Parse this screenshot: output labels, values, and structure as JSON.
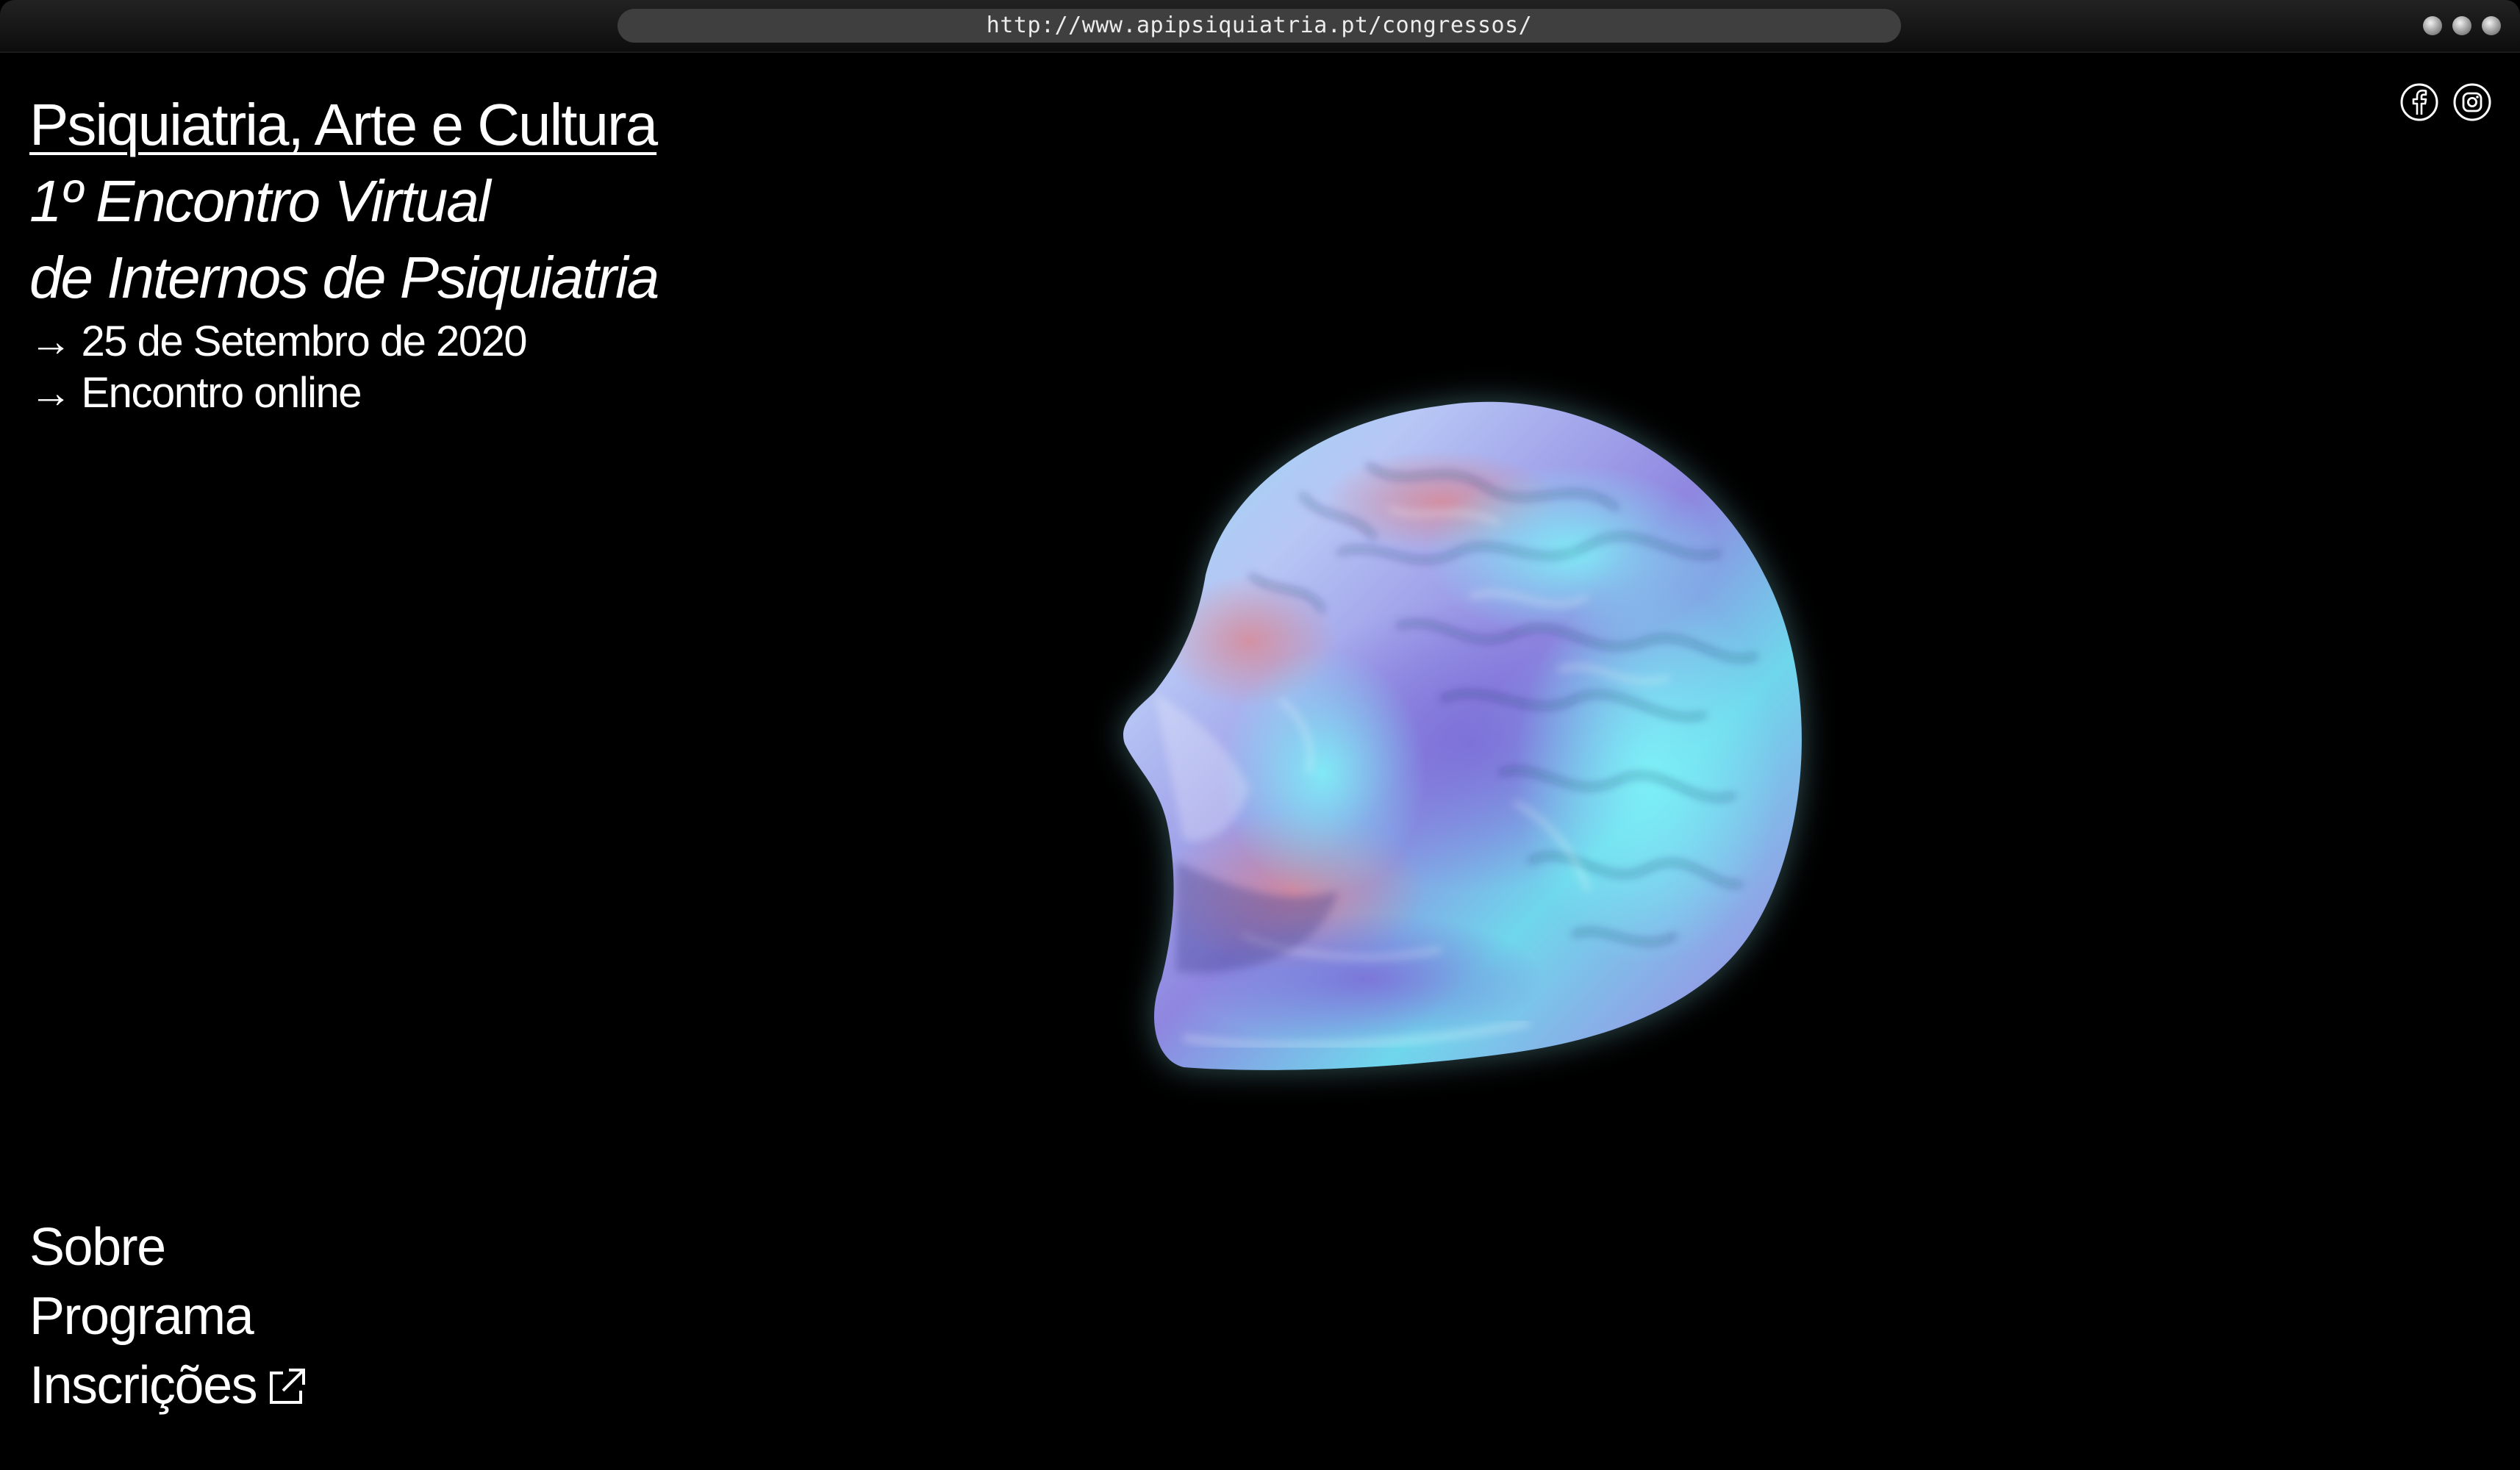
{
  "browser": {
    "url": "http://www.apipsiquiatria.pt/congressos/"
  },
  "hero": {
    "title": "Psiquiatria, Arte e Cultura",
    "subtitle_line1": "1º Encontro Virtual",
    "subtitle_line2": "de Internos de Psiquiatria",
    "arrow": "→",
    "date": "25 de Setembro de 2020",
    "location": "Encontro online"
  },
  "socials": [
    {
      "icon": "facebook-icon"
    },
    {
      "icon": "instagram-icon"
    }
  ],
  "artwork": {
    "icon": "holographic-head-sculpture",
    "colors": [
      "#7fe9f2",
      "#8f86e0",
      "#c97f93",
      "#b7c6f5"
    ]
  },
  "nav": {
    "about": "Sobre",
    "program": "Programa",
    "registration": "Inscrições"
  }
}
